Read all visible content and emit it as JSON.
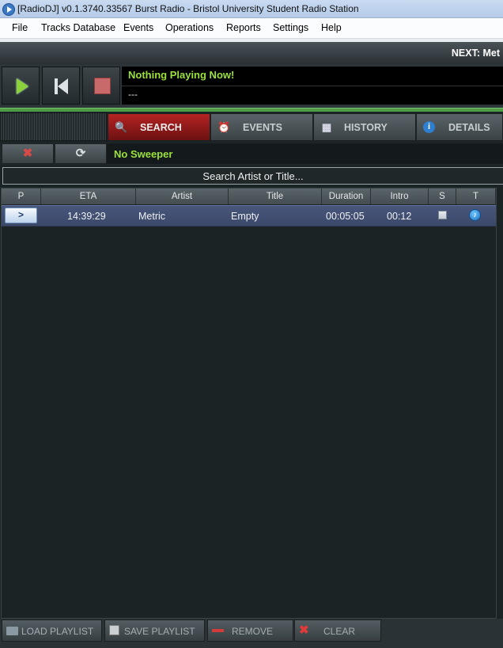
{
  "window": {
    "title": "[RadioDJ] v0.1.3740.33567 Burst Radio - Bristol University Student Radio Station"
  },
  "menu": [
    "File",
    "Tracks Database",
    "Events",
    "Operations",
    "Reports",
    "Settings",
    "Help"
  ],
  "next_label": "NEXT: Met",
  "now_playing": {
    "title": "Nothing Playing Now!",
    "subtitle": "---"
  },
  "tabs": [
    {
      "label": "SEARCH",
      "icon": "magnifier-icon",
      "active": true
    },
    {
      "label": "EVENTS",
      "icon": "alarm-clock-icon",
      "active": false
    },
    {
      "label": "HISTORY",
      "icon": "calendar-icon",
      "active": false
    },
    {
      "label": "DETAILS",
      "icon": "info-icon",
      "active": false
    }
  ],
  "sweeper": {
    "status": "No Sweeper"
  },
  "search": {
    "placeholder": "Search Artist or Title..."
  },
  "playlist": {
    "columns": [
      "P",
      "ETA",
      "Artist",
      "Title",
      "Duration",
      "Intro",
      "S",
      "T"
    ],
    "rows": [
      {
        "p": ">",
        "eta": "14:39:29",
        "artist": "Metric",
        "title": "Empty",
        "duration": "00:05:05",
        "intro": "00:12",
        "s_checked": false,
        "t_icon": "music-note-icon"
      }
    ]
  },
  "bottom_buttons": {
    "load": "LOAD PLAYLIST",
    "save": "SAVE PLAYLIST",
    "remove": "REMOVE",
    "clear": "CLEAR"
  },
  "colors": {
    "accent_green": "#9be13c",
    "active_tab": "#b52222",
    "row_highlight": "#44527a"
  }
}
